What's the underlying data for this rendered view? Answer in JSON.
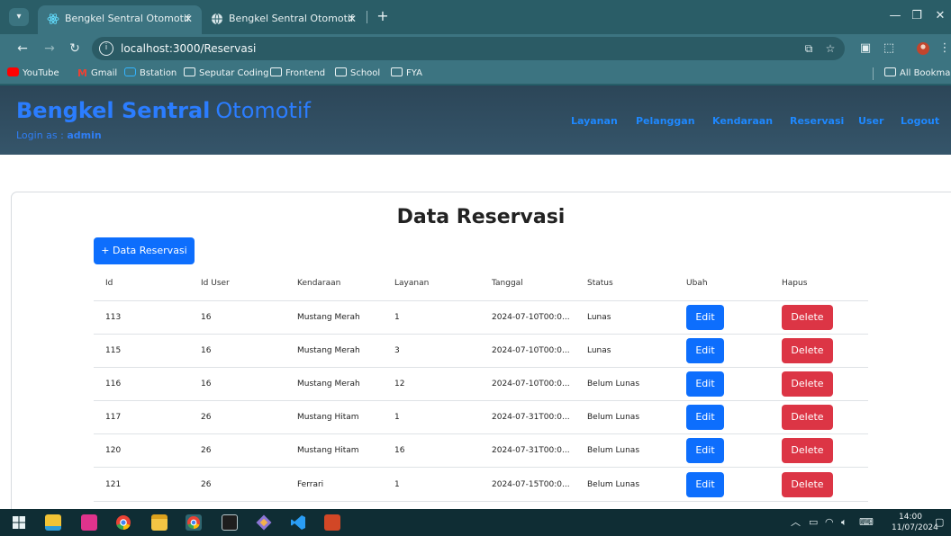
{
  "browser": {
    "tabs": [
      {
        "title": "Bengkel Sentral Otomotif",
        "active": true
      },
      {
        "title": "Bengkel Sentral Otomotif",
        "active": false
      }
    ],
    "new_tab": "+",
    "url": "localhost:3000/Reservasi",
    "bookmarks": [
      "YouTube",
      "Gmail",
      "Bstation",
      "Seputar Coding",
      "Frontend",
      "School",
      "FYA"
    ],
    "all_bookmarks": "All Bookmarks"
  },
  "app": {
    "brand_bold": "Bengkel Sentral",
    "brand_light": "Otomotif",
    "login_prefix": "Login as :",
    "login_user": "admin",
    "nav": [
      "Layanan",
      "Pelanggan",
      "Kendaraan",
      "Reservasi",
      "User",
      "Logout"
    ]
  },
  "main": {
    "title": "Data Reservasi",
    "add_button": "+ Data Reservasi",
    "columns": [
      "Id",
      "Id User",
      "Kendaraan",
      "Layanan",
      "Tanggal",
      "Status",
      "Ubah",
      "Hapus"
    ],
    "rows": [
      {
        "id": "113",
        "id_user": "16",
        "kendaraan": "Mustang Merah",
        "layanan": "1",
        "tanggal": "2024-07-10T00:0...",
        "status": "Lunas"
      },
      {
        "id": "115",
        "id_user": "16",
        "kendaraan": "Mustang Merah",
        "layanan": "3",
        "tanggal": "2024-07-10T00:0...",
        "status": "Lunas"
      },
      {
        "id": "116",
        "id_user": "16",
        "kendaraan": "Mustang Merah",
        "layanan": "12",
        "tanggal": "2024-07-10T00:0...",
        "status": "Belum Lunas"
      },
      {
        "id": "117",
        "id_user": "26",
        "kendaraan": "Mustang Hitam",
        "layanan": "1",
        "tanggal": "2024-07-31T00:0...",
        "status": "Belum Lunas"
      },
      {
        "id": "120",
        "id_user": "26",
        "kendaraan": "Mustang Hitam",
        "layanan": "16",
        "tanggal": "2024-07-31T00:0...",
        "status": "Belum Lunas"
      },
      {
        "id": "121",
        "id_user": "26",
        "kendaraan": "Ferrari",
        "layanan": "1",
        "tanggal": "2024-07-15T00:0...",
        "status": "Belum Lunas"
      }
    ],
    "edit_label": "Edit",
    "delete_label": "Delete"
  },
  "taskbar": {
    "time": "14:00",
    "date": "11/07/2024"
  },
  "colors": {
    "primary": "#0d6efd",
    "danger": "#dc3545",
    "header": "#2c4658",
    "brand": "#2b7dff",
    "browser_frame": "#3c7481"
  }
}
